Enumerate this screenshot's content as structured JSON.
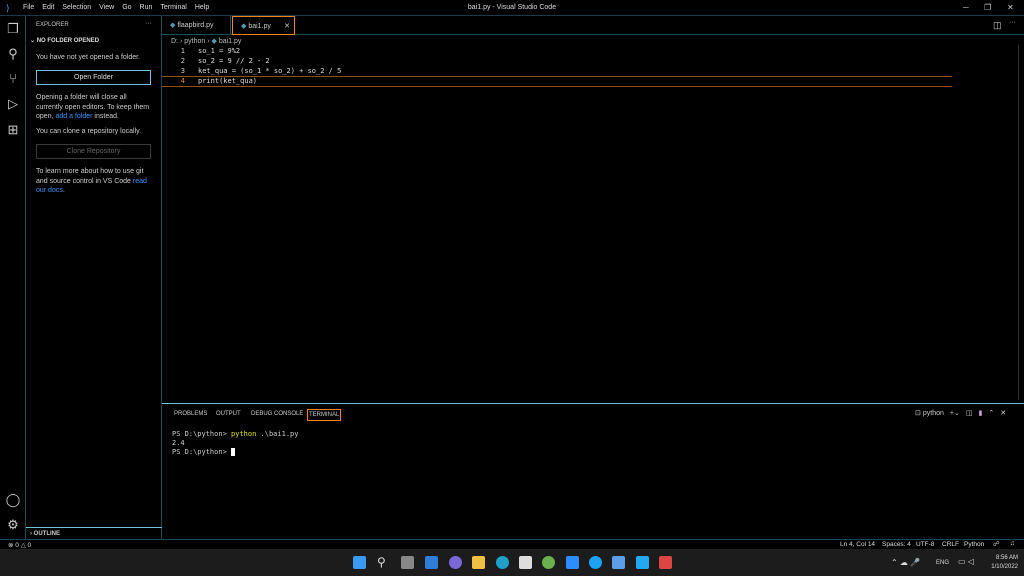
{
  "titlebar": {
    "menu": [
      "File",
      "Edit",
      "Selection",
      "View",
      "Go",
      "Run",
      "Terminal",
      "Help"
    ],
    "title": "bai1.py - Visual Studio Code"
  },
  "sidebar": {
    "header": "EXPLORER",
    "more": "···",
    "section": "NO FOLDER OPENED",
    "msg1": "You have not yet opened a folder.",
    "open_folder": "Open Folder",
    "msg2a": "Opening a folder will close all currently open editors. To keep them open,",
    "msg2_link": "add a folder",
    "msg2b": "instead.",
    "msg3": "You can clone a repository locally.",
    "clone": "Clone Repository",
    "msg4a": "To learn more about how to use git and source control in VS Code",
    "msg4_link": "read our docs",
    "msg4b": ".",
    "outline": "OUTLINE"
  },
  "tabs": [
    {
      "label": "flaapbird.py"
    },
    {
      "label": "bai1.py",
      "active": true
    }
  ],
  "breadcrumb": [
    "D:",
    "python",
    "bai1.py"
  ],
  "code": [
    {
      "n": "1",
      "text": "so_1 = 9%2"
    },
    {
      "n": "2",
      "text": "so_2 = 9 // 2 - 2"
    },
    {
      "n": "3",
      "text": "ket_qua = (so_1 * so_2) + so_2 / 5"
    },
    {
      "n": "4",
      "text": "print(ket_qua)"
    }
  ],
  "panel": {
    "tabs": [
      "PROBLEMS",
      "OUTPUT",
      "DEBUG CONSOLE",
      "TERMINAL"
    ],
    "shell": "python",
    "lines": [
      {
        "prompt": "PS D:\\python> ",
        "cmd": "python",
        "arg": " .\\bai1.py"
      },
      {
        "out": "2.4"
      },
      {
        "prompt": "PS D:\\python> "
      }
    ]
  },
  "status": {
    "errors": "0",
    "warnings": "0",
    "position": "Ln 4, Col 14",
    "spaces": "Spaces: 4",
    "encoding": "UTF-8",
    "eol": "CRLF",
    "language": "Python"
  },
  "taskbar": {
    "lang": "ENG",
    "time": "8:56 AM",
    "date": "1/10/2022"
  },
  "colors": {
    "accent": "#f38518",
    "border": "#6fc3df"
  }
}
